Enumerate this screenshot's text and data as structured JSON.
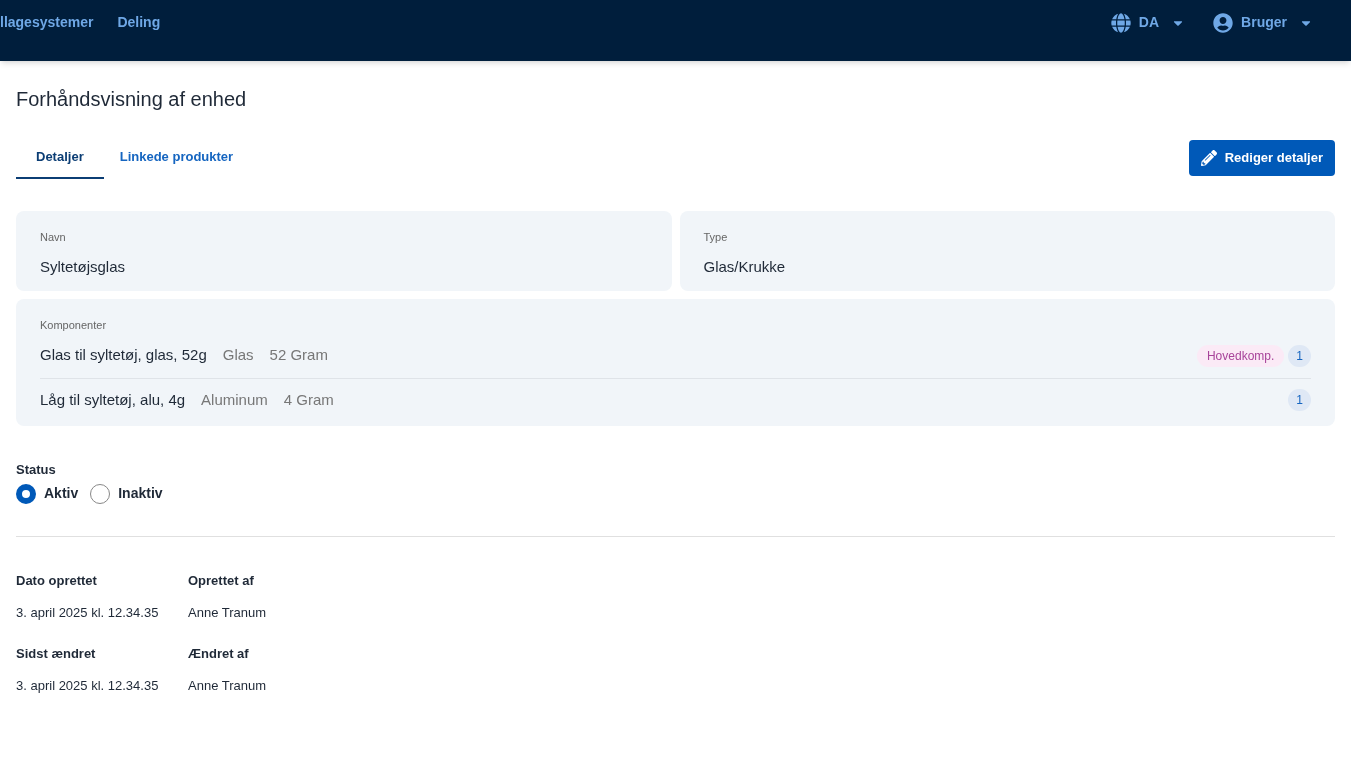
{
  "nav": {
    "links": [
      "llagesystemer",
      "Deling"
    ],
    "language": "DA",
    "user": "Bruger"
  },
  "page": {
    "title": "Forhåndsvisning af enhed"
  },
  "tabs": [
    {
      "label": "Detaljer",
      "selected": true
    },
    {
      "label": "Linkede produkter",
      "selected": false
    }
  ],
  "edit_button": "Rediger detaljer",
  "fields": [
    {
      "label": "Navn",
      "value": "Syltetøjsglas"
    },
    {
      "label": "Type",
      "value": "Glas/Krukke"
    }
  ],
  "components": {
    "label": "Komponenter",
    "items": [
      {
        "name": "Glas til syltetøj, glas, 52g",
        "material": "Glas",
        "weight": "52 Gram",
        "tag": "Hovedkomp.",
        "count": "1"
      },
      {
        "name": "Låg til syltetøj, alu, 4g",
        "material": "Aluminum",
        "weight": "4 Gram",
        "count": "1"
      }
    ]
  },
  "status": {
    "label": "Status",
    "options": [
      {
        "label": "Aktiv",
        "selected": true
      },
      {
        "label": "Inaktiv",
        "selected": false
      }
    ]
  },
  "meta": [
    {
      "label": "Dato oprettet",
      "value": "3. april 2025 kl. 12.34.35"
    },
    {
      "label": "Oprettet af",
      "value": "Anne Tranum"
    },
    {
      "label": "Sidst ændret",
      "value": "3. april 2025 kl. 12.34.35"
    },
    {
      "label": "Ændret af",
      "value": "Anne Tranum"
    }
  ]
}
